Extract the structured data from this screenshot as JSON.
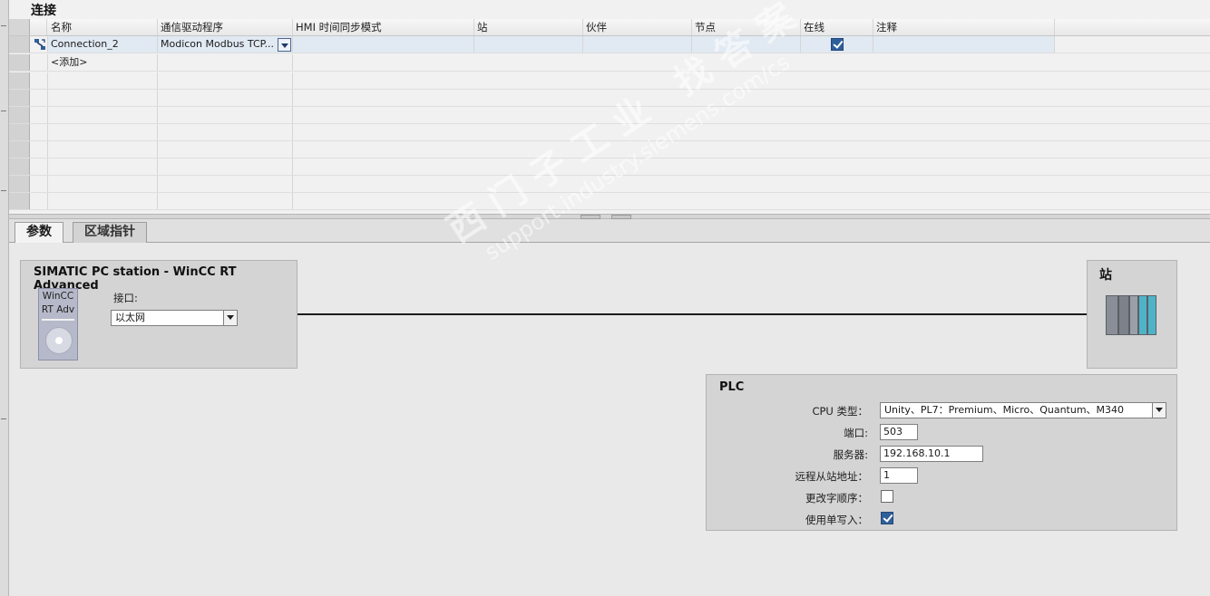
{
  "connection_panel": {
    "title": "连接",
    "columns": [
      "名称",
      "通信驱动程序",
      "HMI 时间同步模式",
      "站",
      "伙伴",
      "节点",
      "在线",
      "注释"
    ],
    "rows": [
      {
        "name": "Connection_2",
        "driver": "Modicon Modbus TCP...",
        "hmi_sync": "",
        "station": "",
        "partner": "",
        "node": "",
        "online": true,
        "comment": ""
      }
    ],
    "add_row_label": "<添加>",
    "icons": {
      "connection": "connection-icon",
      "driver_dropdown": "chevron-down-icon"
    }
  },
  "tabs": [
    {
      "label": "参数",
      "active": true
    },
    {
      "label": "区域指针",
      "active": false
    }
  ],
  "hmi_station": {
    "title": "SIMATIC PC station - WinCC RT Advanced",
    "image_line1": "WinCC",
    "image_line2": "RT Adv",
    "interface_label": "接口:",
    "interface_value": "以太网"
  },
  "station": {
    "title": "站"
  },
  "plc": {
    "title": "PLC",
    "cpu_type_label": "CPU 类型：",
    "cpu_type_value": "Unity、PL7：Premium、Micro、Quantum、M340",
    "port_label": "端口:",
    "port_value": "503",
    "server_label": "服务器:",
    "server_value": "192.168.10.1",
    "slave_address_label": "远程从站地址：",
    "slave_address_value": "1",
    "byte_order_label": "更改字顺序：",
    "byte_order_checked": false,
    "single_write_label": "使用单写入：",
    "single_write_checked": true
  },
  "watermark": {
    "line1": "西门子工业  找答案",
    "line2": "support.industry.siemens.com/cs"
  },
  "colors": {
    "selected_row": "#e1e9f2",
    "checkbox_on": "#2f5f9a",
    "panel_bg": "#d4d4d4"
  }
}
